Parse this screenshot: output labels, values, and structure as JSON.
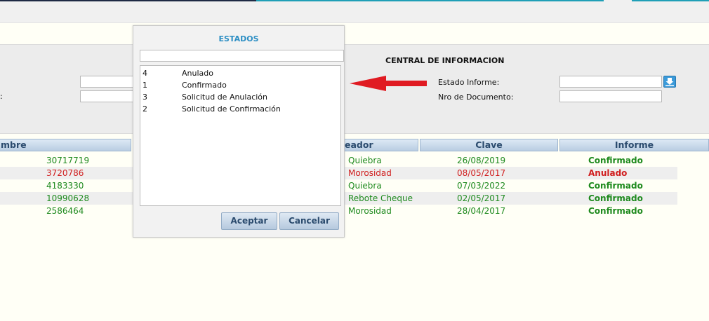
{
  "header": {
    "title": "CENTRAL DE INFORMACION"
  },
  "filters": {
    "left_label_2": ":",
    "estado_informe_label": "Estado Informe:",
    "nro_documento_label": "Nro de Documento:"
  },
  "grid": {
    "columns": [
      "mbre",
      "eador",
      "Clave",
      "Informe"
    ],
    "rows": [
      {
        "doc": "30717719",
        "type": "Quiebra",
        "date": "26/08/2019",
        "status": "Confirmado",
        "color": "#1e8a1e"
      },
      {
        "doc": "3720786",
        "type": "Morosidad",
        "date": "08/05/2017",
        "status": "Anulado",
        "color": "#d01e1e"
      },
      {
        "doc": "4183330",
        "type": "Quiebra",
        "date": "07/03/2022",
        "status": "Confirmado",
        "color": "#1e8a1e"
      },
      {
        "doc": "10990628",
        "type": "Rebote Cheque",
        "date": "02/05/2017",
        "status": "Confirmado",
        "color": "#1e8a1e"
      },
      {
        "doc": "2586464",
        "type": "Morosidad",
        "date": "28/04/2017",
        "status": "Confirmado",
        "color": "#1e8a1e"
      }
    ]
  },
  "modal": {
    "title": "ESTADOS",
    "search_value": "",
    "items": [
      {
        "code": "4",
        "label": "Anulado"
      },
      {
        "code": "1",
        "label": "Confirmado"
      },
      {
        "code": "3",
        "label": "Solicitud de Anulación"
      },
      {
        "code": "2",
        "label": "Solicitud de Confirmación"
      }
    ],
    "accept_label": "Aceptar",
    "cancel_label": "Cancelar"
  },
  "icons": {
    "download": "download-icon",
    "arrow": "red-arrow-icon"
  },
  "colors": {
    "confirmed": "#1e8a1e",
    "annulled": "#d01e1e",
    "modal_title": "#2d8fc4",
    "grid_header_text": "#2b4b6e"
  }
}
